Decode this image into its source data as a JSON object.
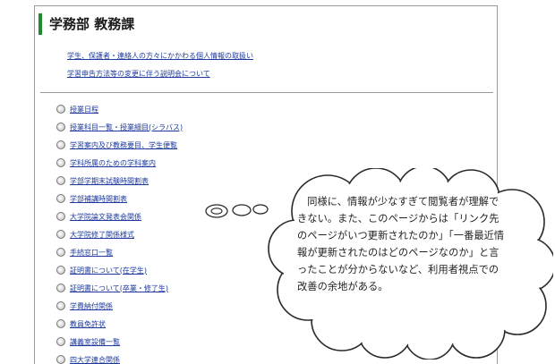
{
  "header": {
    "title": "学務部 教務課"
  },
  "notices": [
    "学生、保護者・連絡人の方々にかかわる個人情報の取扱い",
    "学習申告方法等の変更に伴う説明会について"
  ],
  "links": [
    "授業日程",
    "授業科目一覧・授業細目(シラバス)",
    "学習案内及び教務要目、学生便覧",
    "学科所属のための学科案内",
    "学部学期末試験時間割表",
    "学部補講時間割表",
    "大学院論文発表会関係",
    "大学院修了関係様式",
    "手続窓口一覧",
    "証明書について(在学生)",
    "証明書について(卒業・修了生)",
    "学費納付関係",
    "教員免許状",
    "講義室設備一覧",
    "四大学連合関係"
  ],
  "callout": {
    "text": "同様に、情報が少なすぎて閲覧者が理解できない。また、このページからは「リンク先のページがいつ更新されたのか」「一番最近情報が更新されたのはどのページなのか」と言ったことが分からないなど、利用者視点での改善の余地がある。"
  }
}
